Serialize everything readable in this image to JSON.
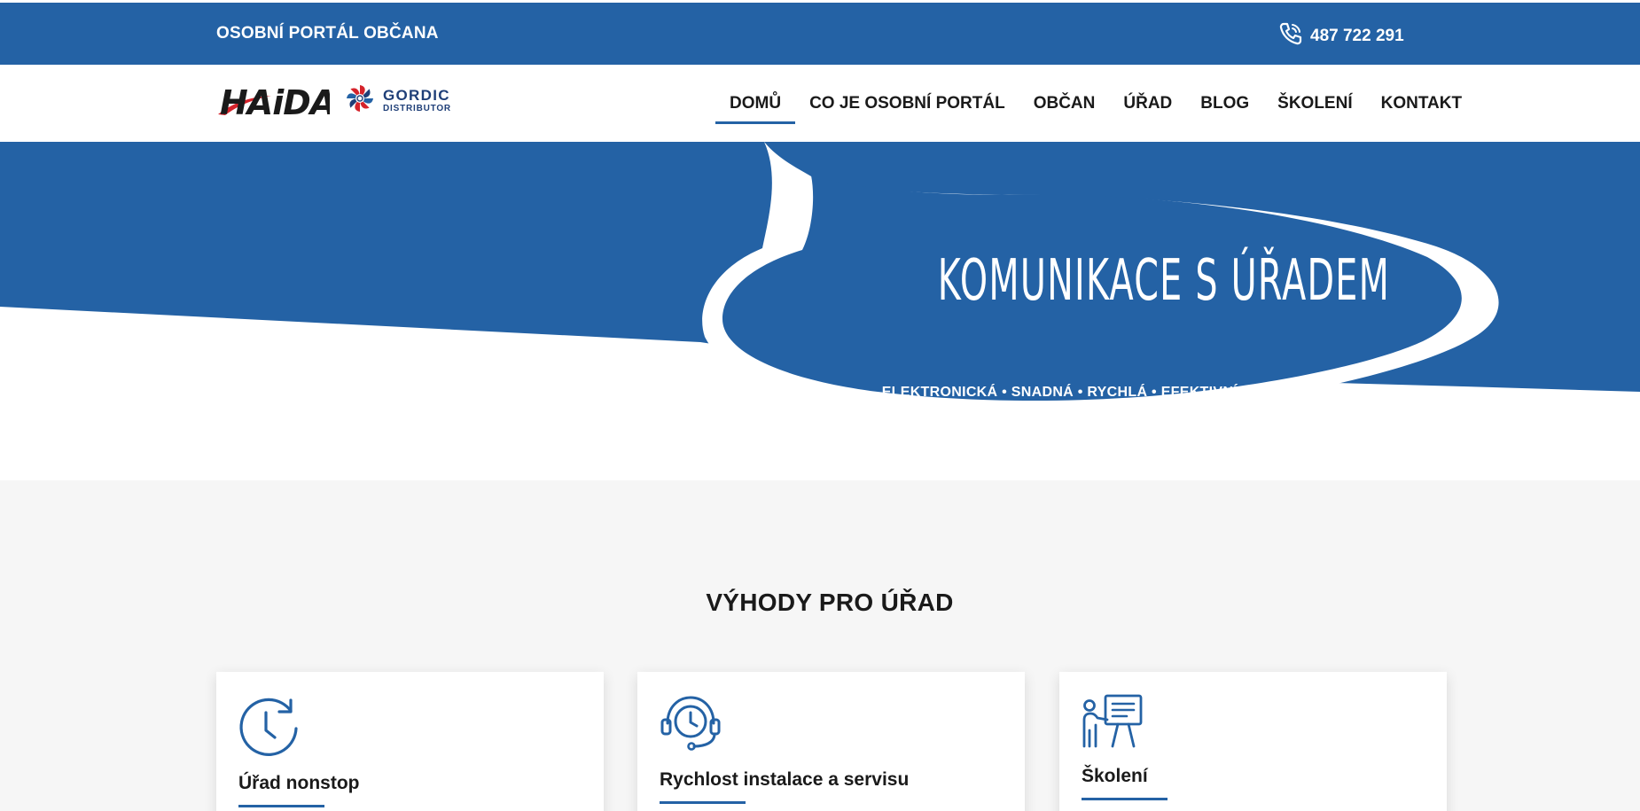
{
  "topbar": {
    "portal_label": "OSOBNÍ PORTÁL OBČANA",
    "phone_icon": "phone-icon",
    "phone_number": "487 722 291"
  },
  "header": {
    "logo_haida": "HAiDA",
    "logo_gordic_name": "GORDIC",
    "logo_gordic_sub": "DISTRIBUTOR"
  },
  "nav": {
    "items": [
      {
        "label": "DOMŮ",
        "active": true
      },
      {
        "label": "CO JE OSOBNÍ PORTÁL",
        "active": false
      },
      {
        "label": "OBČAN",
        "active": false
      },
      {
        "label": "ÚŘAD",
        "active": false
      },
      {
        "label": "BLOG",
        "active": false
      },
      {
        "label": "ŠKOLENÍ",
        "active": false
      },
      {
        "label": "KONTAKT",
        "active": false
      }
    ]
  },
  "hero": {
    "headline": "KOMUNIKACE S ÚŘADEM",
    "tagline": "ELEKTRONICKÁ • SNADNÁ • RYCHLÁ • EFEKTIVNÍ • POHODLNÁ"
  },
  "benefits": {
    "title": "VÝHODY PRO ÚŘAD",
    "cards": [
      {
        "icon": "clock-refresh-icon",
        "title": "Úřad nonstop"
      },
      {
        "icon": "headset-clock-icon",
        "title": "Rychlost instalace a servisu"
      },
      {
        "icon": "training-presentation-icon",
        "title": "Školení"
      }
    ]
  },
  "colors": {
    "brand_blue": "#2462a5",
    "haida_red": "#d5232b",
    "section_bg": "#f6f6f6"
  }
}
